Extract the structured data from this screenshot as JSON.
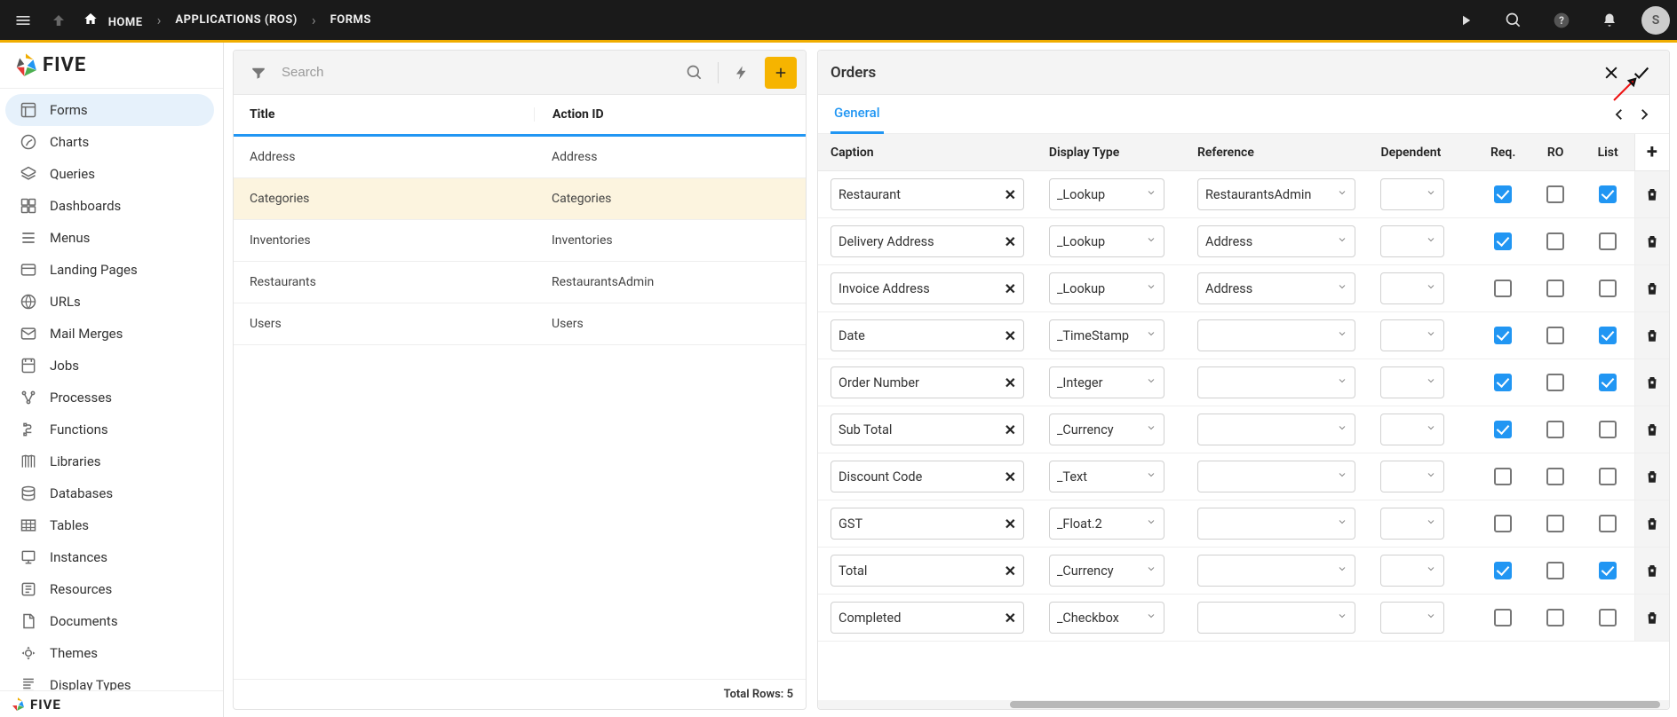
{
  "topbar": {
    "breadcrumb": [
      {
        "label": "HOME",
        "has_icon": true
      },
      {
        "label": "APPLICATIONS (ROS)"
      },
      {
        "label": "FORMS"
      }
    ],
    "avatar_letter": "S"
  },
  "sidebar": {
    "brand": "FIVE",
    "items": [
      {
        "label": "Forms",
        "selected": true
      },
      {
        "label": "Charts"
      },
      {
        "label": "Queries"
      },
      {
        "label": "Dashboards"
      },
      {
        "label": "Menus"
      },
      {
        "label": "Landing Pages"
      },
      {
        "label": "URLs"
      },
      {
        "label": "Mail Merges"
      },
      {
        "label": "Jobs"
      },
      {
        "label": "Processes"
      },
      {
        "label": "Functions"
      },
      {
        "label": "Libraries"
      },
      {
        "label": "Databases"
      },
      {
        "label": "Tables"
      },
      {
        "label": "Instances"
      },
      {
        "label": "Resources"
      },
      {
        "label": "Documents"
      },
      {
        "label": "Themes"
      },
      {
        "label": "Display Types"
      }
    ],
    "footer_brand": "FIVE"
  },
  "list_panel": {
    "search_placeholder": "Search",
    "columns": {
      "title": "Title",
      "action": "Action ID"
    },
    "rows": [
      {
        "title": "Address",
        "action": "Address"
      },
      {
        "title": "Categories",
        "action": "Categories",
        "selected": true
      },
      {
        "title": "Inventories",
        "action": "Inventories"
      },
      {
        "title": "Restaurants",
        "action": "RestaurantsAdmin"
      },
      {
        "title": "Users",
        "action": "Users"
      }
    ],
    "footer_label": "Total Rows:",
    "footer_count": "5"
  },
  "detail_panel": {
    "title": "Orders",
    "tab_label": "General",
    "grid_head": {
      "caption": "Caption",
      "display_type": "Display Type",
      "reference": "Reference",
      "dependent": "Dependent",
      "req": "Req.",
      "ro": "RO",
      "list": "List"
    },
    "rows": [
      {
        "caption": "Restaurant",
        "display": "_Lookup",
        "reference": "RestaurantsAdmin",
        "dependent": "",
        "req": true,
        "ro": false,
        "list": true
      },
      {
        "caption": "Delivery Address",
        "display": "_Lookup",
        "reference": "Address",
        "dependent": "",
        "req": true,
        "ro": false,
        "list": false
      },
      {
        "caption": "Invoice Address",
        "display": "_Lookup",
        "reference": "Address",
        "dependent": "",
        "req": false,
        "ro": false,
        "list": false
      },
      {
        "caption": "Date",
        "display": "_TimeStamp",
        "reference": "",
        "dependent": "",
        "req": true,
        "ro": false,
        "list": true
      },
      {
        "caption": "Order Number",
        "display": "_Integer",
        "reference": "",
        "dependent": "",
        "req": true,
        "ro": false,
        "list": true
      },
      {
        "caption": "Sub Total",
        "display": "_Currency",
        "reference": "",
        "dependent": "",
        "req": true,
        "ro": false,
        "list": false
      },
      {
        "caption": "Discount Code",
        "display": "_Text",
        "reference": "",
        "dependent": "",
        "req": false,
        "ro": false,
        "list": false
      },
      {
        "caption": "GST",
        "display": "_Float.2",
        "reference": "",
        "dependent": "",
        "req": false,
        "ro": false,
        "list": false
      },
      {
        "caption": "Total",
        "display": "_Currency",
        "reference": "",
        "dependent": "",
        "req": true,
        "ro": false,
        "list": true
      },
      {
        "caption": "Completed",
        "display": "_Checkbox",
        "reference": "",
        "dependent": "",
        "req": false,
        "ro": false,
        "list": false
      }
    ]
  }
}
